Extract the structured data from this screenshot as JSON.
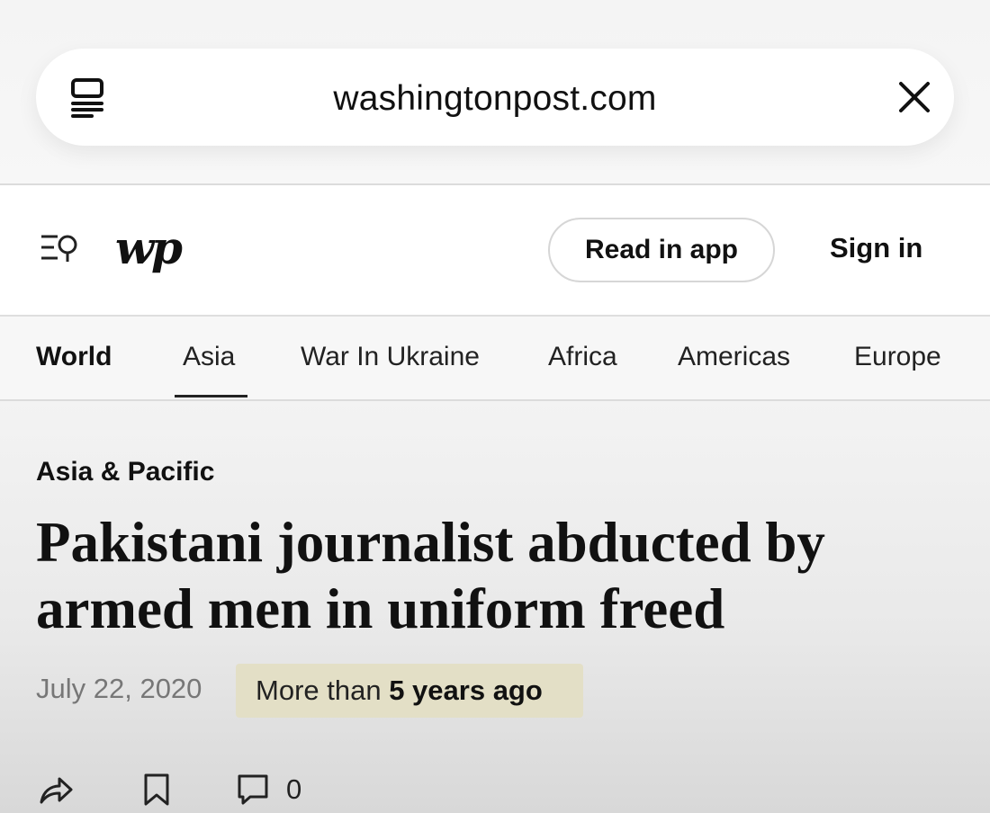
{
  "browser": {
    "url": "washingtonpost.com",
    "reader_icon": "reader-mode-icon",
    "close_icon": "close-icon"
  },
  "header": {
    "logo_text": "wp",
    "menu_icon": "menu-search-icon",
    "read_in_app_label": "Read in app",
    "sign_in_label": "Sign in"
  },
  "nav": {
    "items": [
      {
        "label": "World",
        "active": false,
        "bold": true
      },
      {
        "label": "Asia",
        "active": true,
        "bold": false
      },
      {
        "label": "War In Ukraine",
        "active": false,
        "bold": false
      },
      {
        "label": "Africa",
        "active": false,
        "bold": false
      },
      {
        "label": "Americas",
        "active": false,
        "bold": false
      },
      {
        "label": "Europe",
        "active": false,
        "bold": false
      }
    ]
  },
  "article": {
    "kicker": "Asia & Pacific",
    "headline": "Pakistani journalist abducted by armed men in uniform freed",
    "date": "July 22, 2020",
    "age_prefix": "More than",
    "age_value": "5 years ago",
    "comment_count": "0",
    "actions": [
      "share-icon",
      "bookmark-icon",
      "comment-icon"
    ]
  },
  "colors": {
    "badge_bg": "#e3dfc6",
    "date_text": "#777777",
    "text": "#111111"
  }
}
